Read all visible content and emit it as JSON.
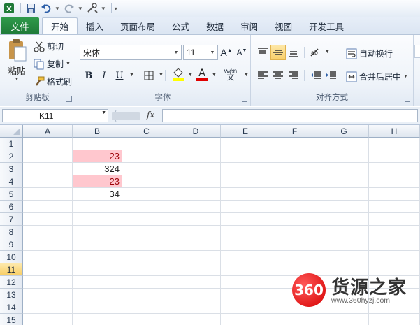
{
  "tabs": {
    "file": "文件",
    "items": [
      "开始",
      "插入",
      "页面布局",
      "公式",
      "数据",
      "审阅",
      "视图",
      "开发工具"
    ]
  },
  "clipboard": {
    "paste": "粘贴",
    "cut": "剪切",
    "copy": "复制",
    "format_painter": "格式刷",
    "label": "剪贴板"
  },
  "font": {
    "name": "宋体",
    "size": "11",
    "label": "字体",
    "bold": "B",
    "italic": "I",
    "underline": "U",
    "wen": "wén"
  },
  "alignment": {
    "wrap_text": "自动换行",
    "merge_center": "合并后居中",
    "label": "对齐方式"
  },
  "formula_bar": {
    "name_box": "K11",
    "fx": "fx",
    "value": ""
  },
  "grid": {
    "columns": [
      "A",
      "B",
      "C",
      "D",
      "E",
      "F",
      "G",
      "H"
    ],
    "rows": [
      "1",
      "2",
      "3",
      "4",
      "5",
      "6",
      "7",
      "8",
      "9",
      "10",
      "11",
      "12",
      "13",
      "14",
      "15"
    ],
    "selected_row": "11",
    "cells": [
      {
        "ref": "B2",
        "value": "23",
        "highlight": true
      },
      {
        "ref": "B3",
        "value": "324",
        "highlight": false
      },
      {
        "ref": "B4",
        "value": "23",
        "highlight": true
      },
      {
        "ref": "B5",
        "value": "34",
        "highlight": false
      }
    ]
  },
  "colors": {
    "accent_file": "#1f7a38",
    "highlight_fill": "#ffc7ce",
    "highlight_text": "#9c0006",
    "selected_row": "#f8cd63"
  },
  "watermark": {
    "logo": "360",
    "title": "货源之家",
    "url": "www.360hyzj.com"
  }
}
